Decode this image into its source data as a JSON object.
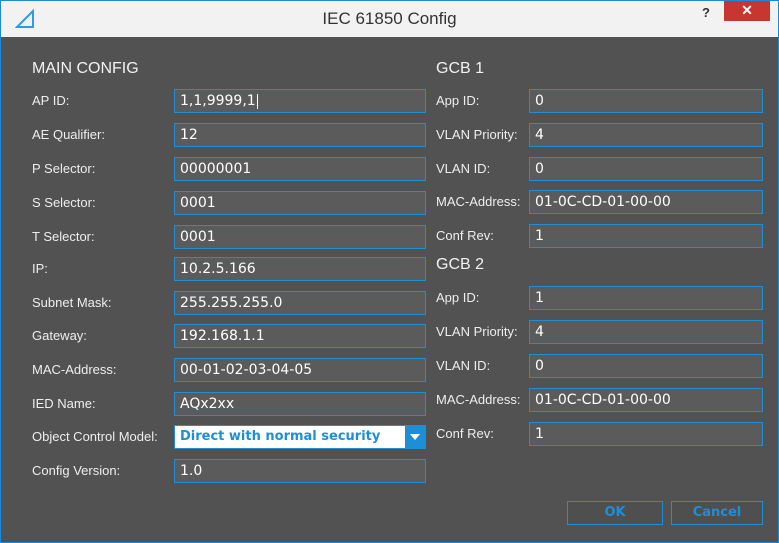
{
  "window": {
    "title": "IEC 61850 Config",
    "help": "?",
    "close": "✕"
  },
  "main": {
    "title": "MAIN CONFIG",
    "fields": [
      {
        "label": "AP ID:",
        "value": "1,1,9999,1"
      },
      {
        "label": "AE Qualifier:",
        "value": "12"
      },
      {
        "label": "P Selector:",
        "value": "00000001"
      },
      {
        "label": "S Selector:",
        "value": "0001"
      },
      {
        "label": "T Selector:",
        "value": "0001"
      },
      {
        "label": "IP:",
        "value": "10.2.5.166"
      },
      {
        "label": "Subnet Mask:",
        "value": "255.255.255.0"
      },
      {
        "label": "Gateway:",
        "value": "192.168.1.1"
      },
      {
        "label": "MAC-Address:",
        "value": "00-01-02-03-04-05"
      },
      {
        "label": "IED Name:",
        "value": "AQx2xx"
      }
    ],
    "object_control": {
      "label": "Object Control Model:",
      "value": "Direct with normal security"
    },
    "config_version": {
      "label": "Config Version:",
      "value": "1.0"
    }
  },
  "gcb1": {
    "title": "GCB 1",
    "fields": [
      {
        "label": "App ID:",
        "value": "0"
      },
      {
        "label": "VLAN Priority:",
        "value": "4"
      },
      {
        "label": "VLAN ID:",
        "value": "0"
      },
      {
        "label": "MAC-Address:",
        "value": "01-0C-CD-01-00-00"
      },
      {
        "label": "Conf Rev:",
        "value": "1"
      }
    ]
  },
  "gcb2": {
    "title": "GCB 2",
    "fields": [
      {
        "label": "App ID:",
        "value": "1"
      },
      {
        "label": "VLAN Priority:",
        "value": "4"
      },
      {
        "label": "VLAN ID:",
        "value": "0"
      },
      {
        "label": "MAC-Address:",
        "value": "01-0C-CD-01-00-00"
      },
      {
        "label": "Conf Rev:",
        "value": "1"
      }
    ]
  },
  "buttons": {
    "ok": "OK",
    "cancel": "Cancel"
  },
  "colors": {
    "accent": "#1e8fd6",
    "background": "#525252",
    "close": "#c7372f"
  }
}
